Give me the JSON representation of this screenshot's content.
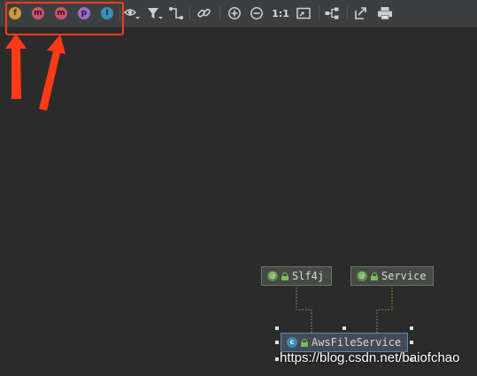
{
  "toolbar": {
    "member_filters": [
      {
        "icon": "field-icon",
        "letter": "f",
        "color": "#c89a3a",
        "text_color": "#4a3000"
      },
      {
        "icon": "constructor-icon",
        "letter": "m",
        "color": "#c7566c",
        "text_color": "#4a0a18"
      },
      {
        "icon": "method-icon",
        "letter": "m",
        "color": "#c7566c",
        "text_color": "#4a0a18"
      },
      {
        "icon": "property-icon",
        "letter": "p",
        "color": "#9b6ec3",
        "text_color": "#2c1040"
      },
      {
        "icon": "inner-class-icon",
        "letter": "I",
        "color": "#3b8fb5",
        "text_color": "#08344a"
      }
    ],
    "actual_size_label": "1:1"
  },
  "diagram": {
    "nodes": [
      {
        "id": "slf4j",
        "label": "Slf4j",
        "kind": "annotation",
        "icon_letter": "@"
      },
      {
        "id": "service",
        "label": "Service",
        "kind": "annotation",
        "icon_letter": "@"
      },
      {
        "id": "awsfileservice",
        "label": "AwsFileService",
        "kind": "class",
        "icon_letter": "c"
      }
    ]
  },
  "watermark": "https://blog.csdn.net/baiofchao",
  "colors": {
    "background": "#2b2b2b",
    "toolbar": "#3c3f41",
    "highlight": "#ff3a17"
  }
}
